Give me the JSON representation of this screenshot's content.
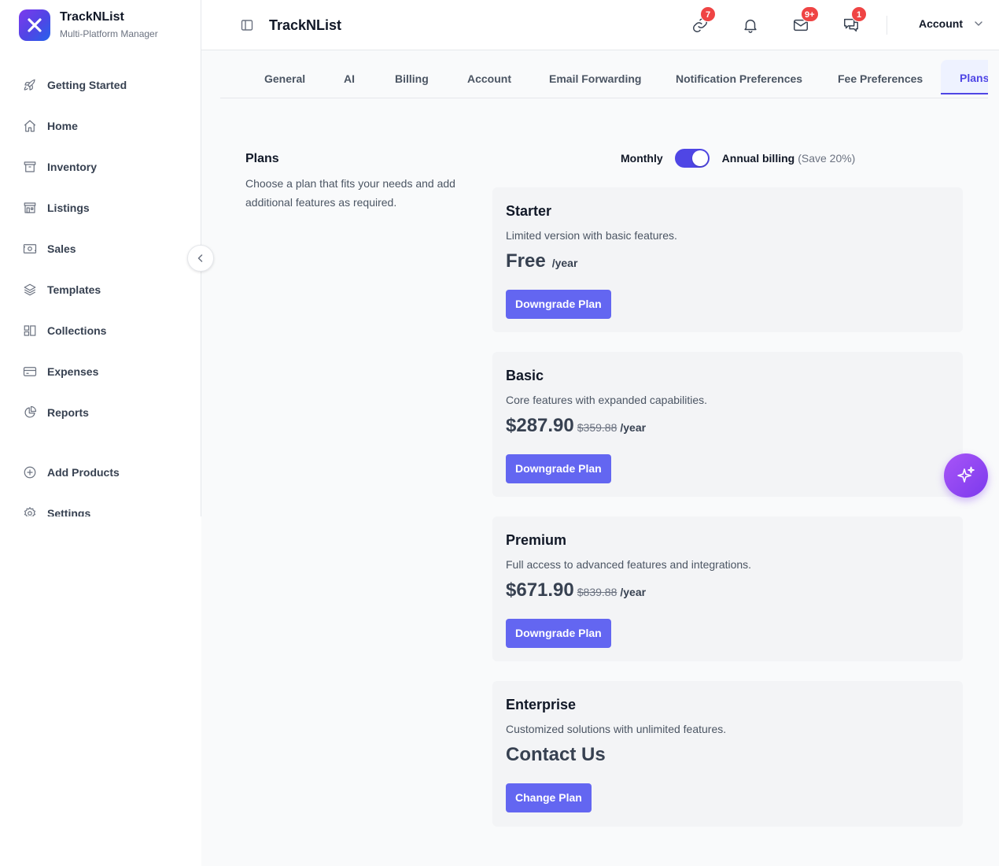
{
  "brand": {
    "name": "TrackNList",
    "subtitle": "Multi-Platform Manager"
  },
  "sidebar": {
    "items": [
      {
        "label": "Getting Started",
        "icon": "rocket-icon"
      },
      {
        "label": "Home",
        "icon": "home-icon"
      },
      {
        "label": "Inventory",
        "icon": "archive-icon"
      },
      {
        "label": "Listings",
        "icon": "store-icon"
      },
      {
        "label": "Sales",
        "icon": "cash-icon"
      },
      {
        "label": "Templates",
        "icon": "layers-icon"
      },
      {
        "label": "Collections",
        "icon": "collection-icon"
      },
      {
        "label": "Expenses",
        "icon": "credit-card-icon"
      },
      {
        "label": "Reports",
        "icon": "pie-chart-icon"
      },
      {
        "label": "Add Products",
        "icon": "plus-circle-icon"
      },
      {
        "label": "Settings",
        "icon": "gear-icon"
      }
    ]
  },
  "header": {
    "title": "TrackNList",
    "badges": {
      "links": "7",
      "mail": "9+",
      "chat": "1"
    },
    "account_label": "Account"
  },
  "tabs": [
    "General",
    "AI",
    "Billing",
    "Account",
    "Email Forwarding",
    "Notification Preferences",
    "Fee Preferences",
    "Plans"
  ],
  "active_tab": "Plans",
  "plans_section": {
    "title": "Plans",
    "description": "Choose a plan that fits your needs and add additional features as required."
  },
  "billing_toggle": {
    "monthly_label": "Monthly",
    "annual_label": "Annual billing",
    "save_note": "(Save 20%)",
    "annual_selected": true
  },
  "plans": [
    {
      "name": "Starter",
      "description": "Limited version with basic features.",
      "price": "Free",
      "old_price": "",
      "per": "/year",
      "button": "Downgrade Plan"
    },
    {
      "name": "Basic",
      "description": "Core features with expanded capabilities.",
      "price": "$287.90",
      "old_price": "$359.88",
      "per": "/year",
      "button": "Downgrade Plan"
    },
    {
      "name": "Premium",
      "description": "Full access to advanced features and integrations.",
      "price": "$671.90",
      "old_price": "$839.88",
      "per": "/year",
      "button": "Downgrade Plan"
    },
    {
      "name": "Enterprise",
      "description": "Customized solutions with unlimited features.",
      "price": "Contact Us",
      "old_price": "",
      "per": "",
      "button": "Change Plan"
    }
  ],
  "colors": {
    "accent": "#4f46e5",
    "button": "#6366f1",
    "badge": "#ef4444",
    "fab": "#a855f7"
  }
}
